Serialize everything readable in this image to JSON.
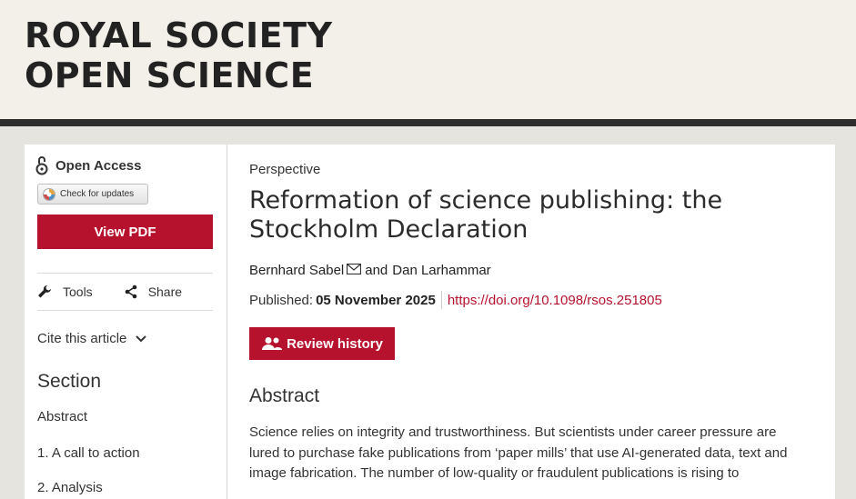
{
  "header": {
    "title_line1": "ROYAL SOCIETY",
    "title_line2": "OPEN SCIENCE"
  },
  "sidebar": {
    "open_access": "Open Access",
    "check_updates": "Check for updates",
    "view_pdf": "View PDF",
    "tools": "Tools",
    "share": "Share",
    "cite": "Cite this article",
    "section_heading": "Section",
    "sections": [
      "Abstract",
      "1. A call to action",
      "2. Analysis"
    ]
  },
  "article": {
    "type": "Perspective",
    "title": "Reformation of science publishing: the Stockholm Declaration",
    "author1": "Bernhard Sabel",
    "and": "and",
    "author2": "Dan Larhammar",
    "published_label": "Published:",
    "published_date": "05 November 2025",
    "doi": "https://doi.org/10.1098/rsos.251805",
    "review_history": "Review history",
    "abstract_heading": "Abstract",
    "abstract_text": "Science relies on integrity and trustworthiness. But scientists under career pressure are lured to purchase fake publications from ‘paper mills’ that use AI-generated data, text and image fabrication. The number of low-quality or fraudulent publications is rising to"
  },
  "colors": {
    "accent": "#b7122d",
    "masthead_bg": "#f3f0ea",
    "page_bg": "#e6e4de",
    "masthead_border": "#2e2e2e"
  },
  "icons": {
    "open_access": "open-access-lock-icon",
    "crossmark": "crossmark-icon",
    "tools": "wrench-icon",
    "share": "share-icon",
    "cite": "chevron-down-icon",
    "email": "envelope-icon",
    "review": "people-icon"
  }
}
